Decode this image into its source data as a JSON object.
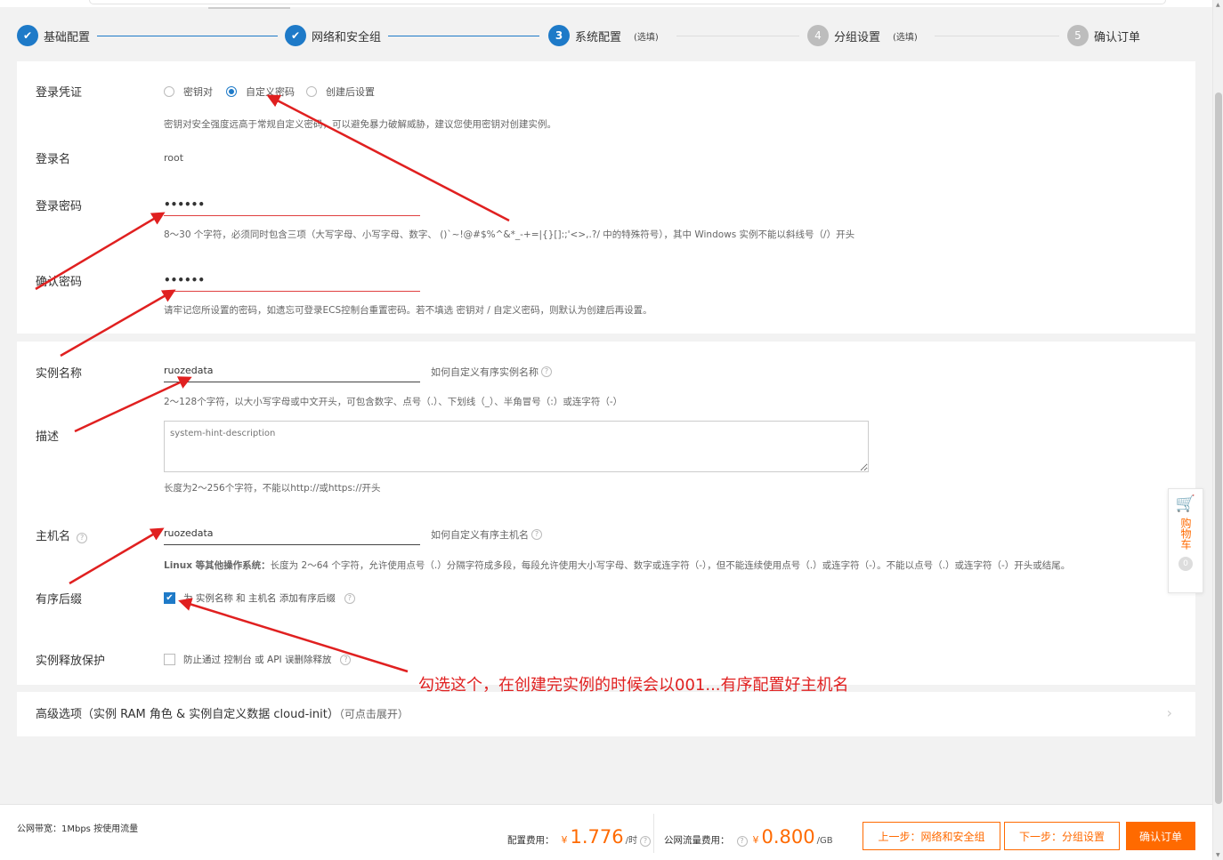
{
  "steps": [
    {
      "label": "基础配置",
      "state": "done",
      "num": ""
    },
    {
      "label": "网络和安全组",
      "state": "done",
      "num": ""
    },
    {
      "label": "系统配置",
      "state": "current",
      "num": "3",
      "optional": "(选填)"
    },
    {
      "label": "分组设置",
      "state": "todo",
      "num": "4",
      "optional": "(选填)"
    },
    {
      "label": "确认订单",
      "state": "todo",
      "num": "5"
    }
  ],
  "login": {
    "credential_label": "登录凭证",
    "options": [
      "密钥对",
      "自定义密码",
      "创建后设置"
    ],
    "selected": "自定义密码",
    "credential_hint": "密钥对安全强度远高于常规自定义密码，可以避免暴力破解威胁，建议您使用密钥对创建实例。",
    "name_label": "登录名",
    "name_value": "root",
    "password_label": "登录密码",
    "password_value": "••••••",
    "password_hint": "8～30 个字符，必须同时包含三项（大写字母、小写字母、数字、 ()`~!@#$%^&*_-+=|{}[]:;'<>,.?/ 中的特殊符号），其中 Windows 实例不能以斜线号（/）开头",
    "confirm_label": "确认密码",
    "confirm_value": "••••••",
    "confirm_hint": "请牢记您所设置的密码，如遗忘可登录ECS控制台重置密码。若不填选 密钥对 / 自定义密码，则默认为创建后再设置。"
  },
  "instance": {
    "name_label": "实例名称",
    "name_value": "ruozedata",
    "name_aside": "如何自定义有序实例名称",
    "name_hint": "2～128个字符，以大小写字母或中文开头，可包含数字、点号（.）、下划线（_）、半角冒号（:）或连字符（-）",
    "desc_label": "描述",
    "desc_placeholder": "system-hint-description",
    "desc_hint": "长度为2～256个字符，不能以http://或https://开头",
    "host_label": "主机名",
    "host_value": "ruozedata",
    "host_aside": "如何自定义有序主机名",
    "host_hint_bold": "Linux 等其他操作系统：",
    "host_hint": "长度为 2～64 个字符，允许使用点号（.）分隔字符成多段，每段允许使用大小写字母、数字或连字符（-），但不能连续使用点号（.）或连字符（-）。不能以点号（.）或连字符（-）开头或结尾。",
    "suffix_label": "有序后缀",
    "suffix_text": "为 实例名称 和 主机名 添加有序后缀",
    "suffix_checked": true,
    "protect_label": "实例释放保护",
    "protect_text": "防止通过 控制台 或 API 误删除释放",
    "protect_checked": false
  },
  "advanced": {
    "title": "高级选项（实例 RAM 角色 & 实例自定义数据 cloud-init）",
    "sub": "（可点击展开）"
  },
  "cart": {
    "label": "购物车",
    "count": "0"
  },
  "footer": {
    "bandwidth": "公网带宽：1Mbps 按使用流量",
    "config_fee_label": "配置费用：",
    "config_fee_currency": "¥",
    "config_fee_value": "1.776",
    "config_fee_unit": "/时",
    "traffic_fee_label": "公网流量费用：",
    "traffic_fee_currency": "¥",
    "traffic_fee_value": "0.800",
    "traffic_fee_unit": "/GB",
    "prev_button": "上一步：网络和安全组",
    "next_button": "下一步：分组设置",
    "confirm_button": "确认订单"
  },
  "annotation": {
    "note": "勾选这个，在创建完实例的时候会以001...有序配置好主机名",
    "color": "#e02020"
  },
  "colors": {
    "accent": "#1e7ac8",
    "orange": "#ff6a00"
  }
}
